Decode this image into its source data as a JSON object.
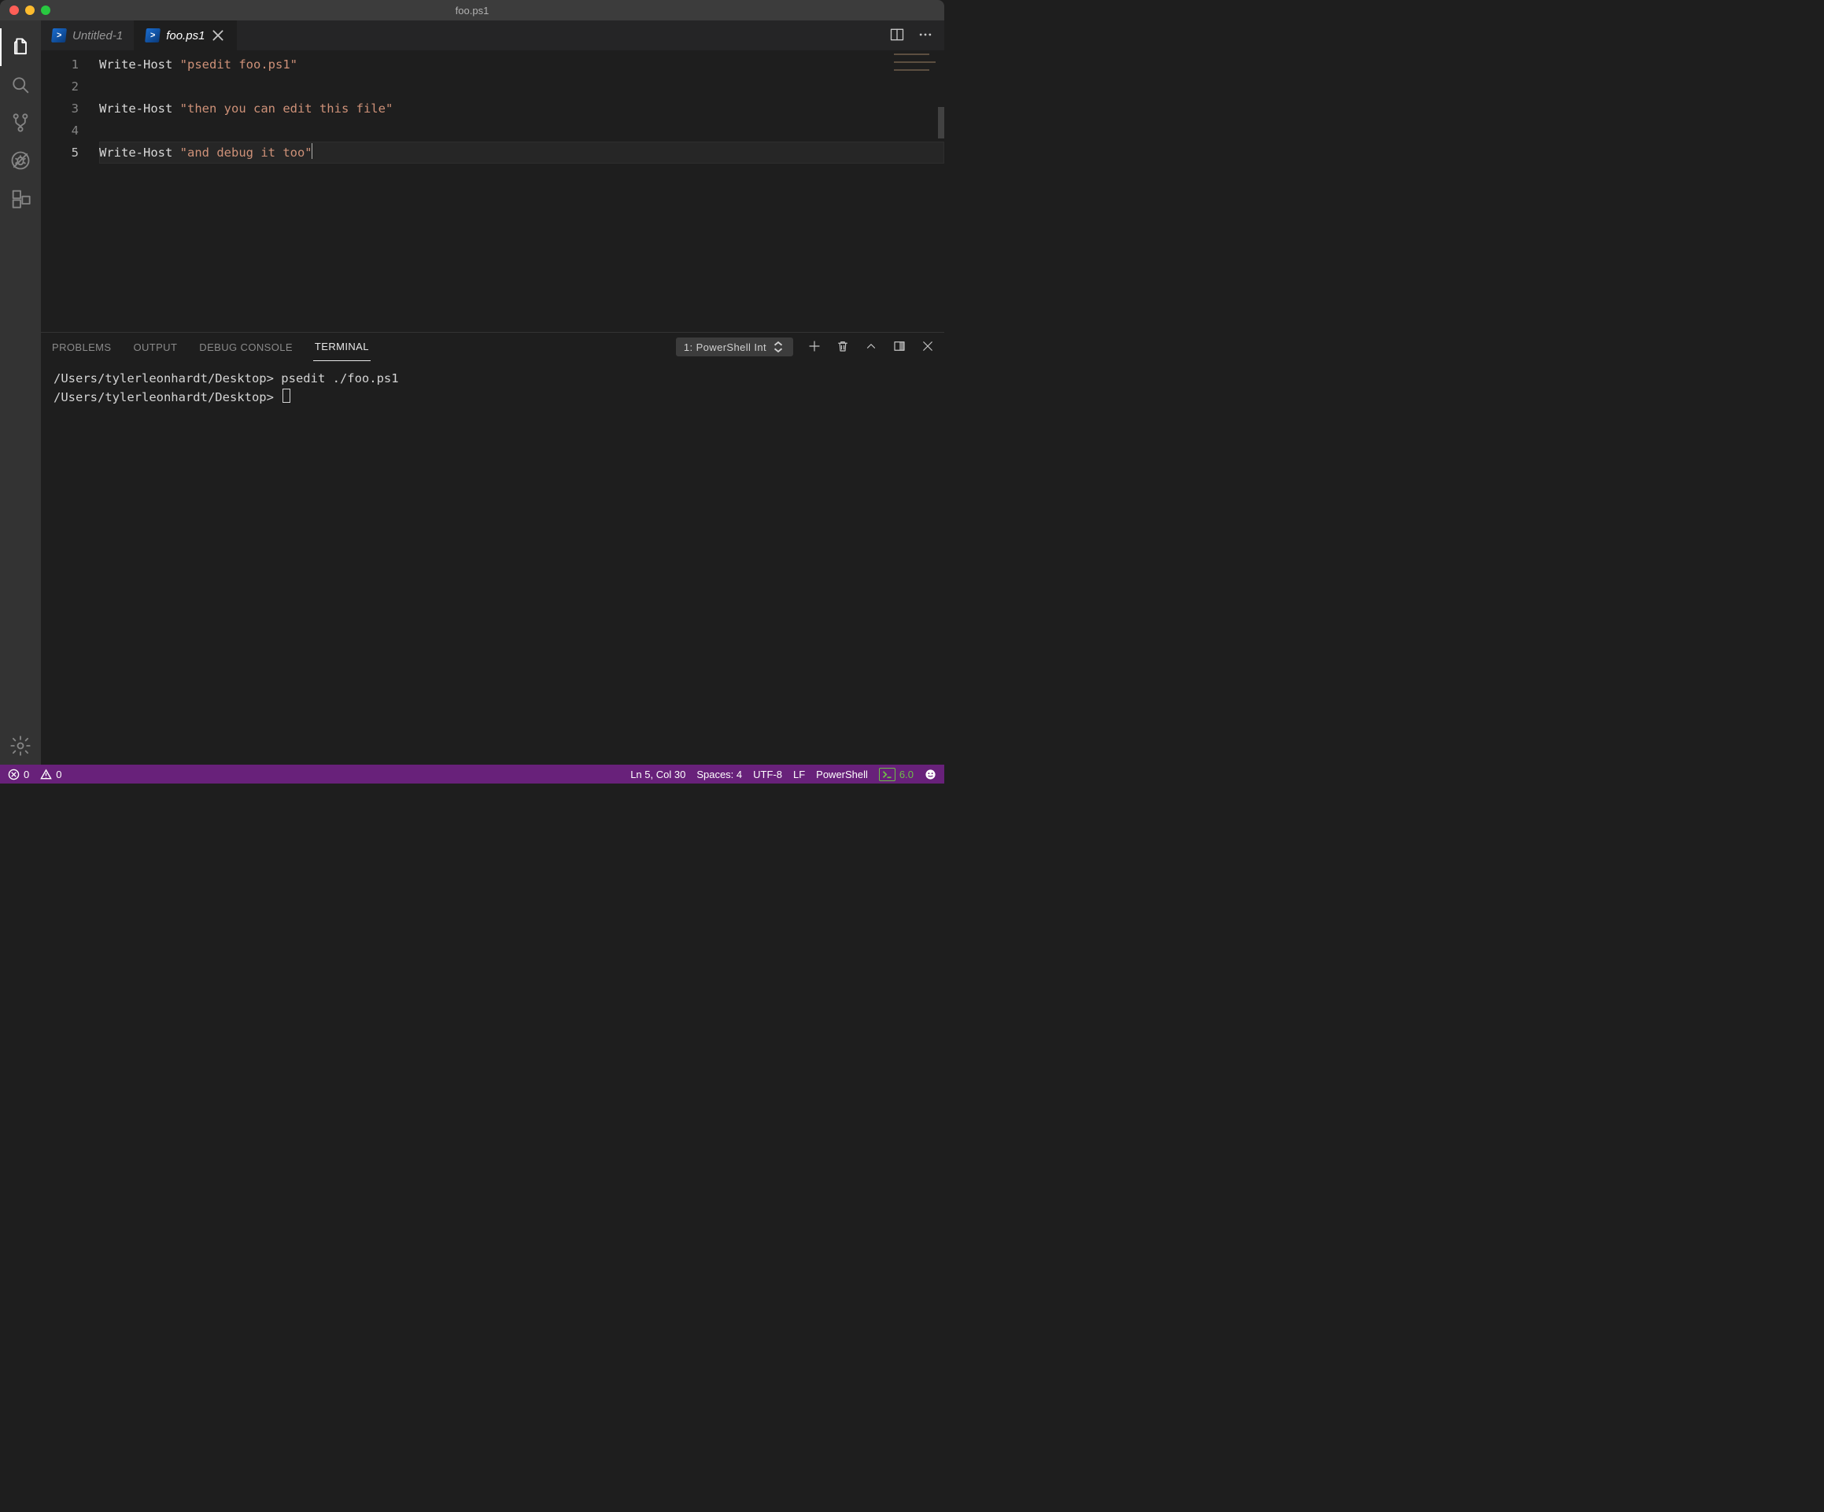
{
  "window": {
    "title": "foo.ps1"
  },
  "tabs": [
    {
      "label": "Untitled-1",
      "active": false,
      "dirty": false
    },
    {
      "label": "foo.ps1",
      "active": true,
      "dirty": true
    }
  ],
  "editor": {
    "lines": [
      {
        "num": "1",
        "cmd": "Write-Host",
        "str": "\"psedit foo.ps1\""
      },
      {
        "num": "2",
        "cmd": "",
        "str": ""
      },
      {
        "num": "3",
        "cmd": "Write-Host",
        "str": "\"then you can edit this file\""
      },
      {
        "num": "4",
        "cmd": "",
        "str": ""
      },
      {
        "num": "5",
        "cmd": "Write-Host",
        "str": "\"and debug it too\""
      }
    ],
    "active_line_index": 4
  },
  "panel": {
    "tabs": {
      "problems": "PROBLEMS",
      "output": "OUTPUT",
      "debug_console": "DEBUG CONSOLE",
      "terminal": "TERMINAL"
    },
    "active_tab": "terminal",
    "terminal_select": "1: PowerShell Int",
    "terminal_lines": [
      "/Users/tylerleonhardt/Desktop> psedit ./foo.ps1",
      "/Users/tylerleonhardt/Desktop> "
    ]
  },
  "status": {
    "errors": "0",
    "warnings": "0",
    "ln_col": "Ln 5, Col 30",
    "spaces": "Spaces: 4",
    "encoding": "UTF-8",
    "eol": "LF",
    "language": "PowerShell",
    "ps_version": "6.0"
  }
}
